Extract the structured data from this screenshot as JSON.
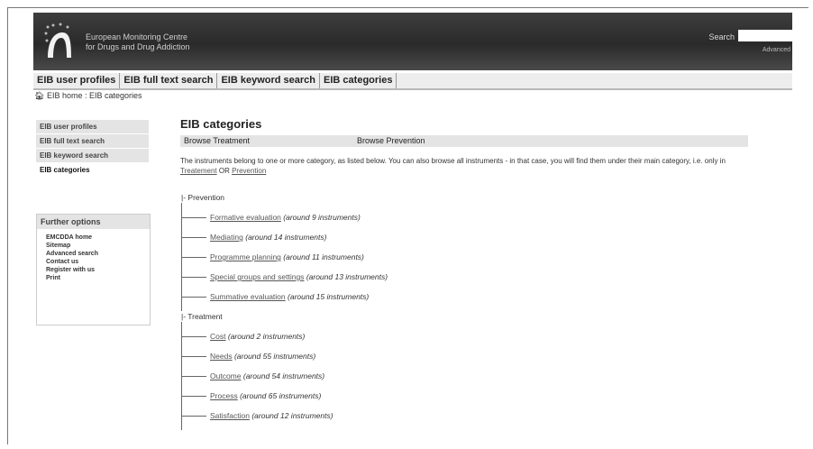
{
  "header": {
    "org_line1": "European Monitoring Centre",
    "org_line2": "for Drugs and Drug Addiction",
    "search_label": "Search",
    "advanced_label": "Advanced"
  },
  "tabs": [
    "EIB user profiles",
    "EIB full text search",
    "EIB keyword search",
    "EIB categories"
  ],
  "breadcrumb": {
    "home": "EIB home",
    "sep": " : ",
    "current": "EIB categories"
  },
  "sidebar": {
    "items": [
      "EIB user profiles",
      "EIB full text search",
      "EIB keyword search",
      "EIB categories"
    ],
    "further_title": "Further options",
    "options": [
      "EMCDDA home",
      "Sitemap",
      "Advanced search",
      "Contact us",
      "Register with us",
      "Print"
    ]
  },
  "main": {
    "title": "EIB categories",
    "browse_treatment": "Browse Treatment",
    "browse_prevention": "Browse Prevention",
    "intro_text": "The instruments belong to one or more category, as listed below. You can also browse all instruments - in that case, you will find them under their main category, i.e. only in",
    "intro_link1": "Treatement",
    "intro_or": "OR",
    "intro_link2": "Prevention"
  },
  "tree": {
    "prevention_label": "|- Prevention",
    "prevention": [
      {
        "name": "Formative evaluation",
        "count": "(around 9 instruments)"
      },
      {
        "name": "Mediating",
        "count": "(around 14 instruments)"
      },
      {
        "name": "Programme planning",
        "count": "(around 11 instruments)"
      },
      {
        "name": "Special groups and settings",
        "count": "(around 13 instruments)"
      },
      {
        "name": "Summative evaluation",
        "count": "(around 15 instruments)"
      }
    ],
    "treatment_label": "|- Treatment",
    "treatment": [
      {
        "name": "Cost",
        "count": "(around 2 instruments)"
      },
      {
        "name": "Needs",
        "count": "(around 55 instruments)"
      },
      {
        "name": "Outcome",
        "count": "(around 54 instruments)"
      },
      {
        "name": "Process",
        "count": "(around 65 instruments)"
      },
      {
        "name": "Satisfaction",
        "count": "(around 12 instruments)"
      }
    ]
  }
}
